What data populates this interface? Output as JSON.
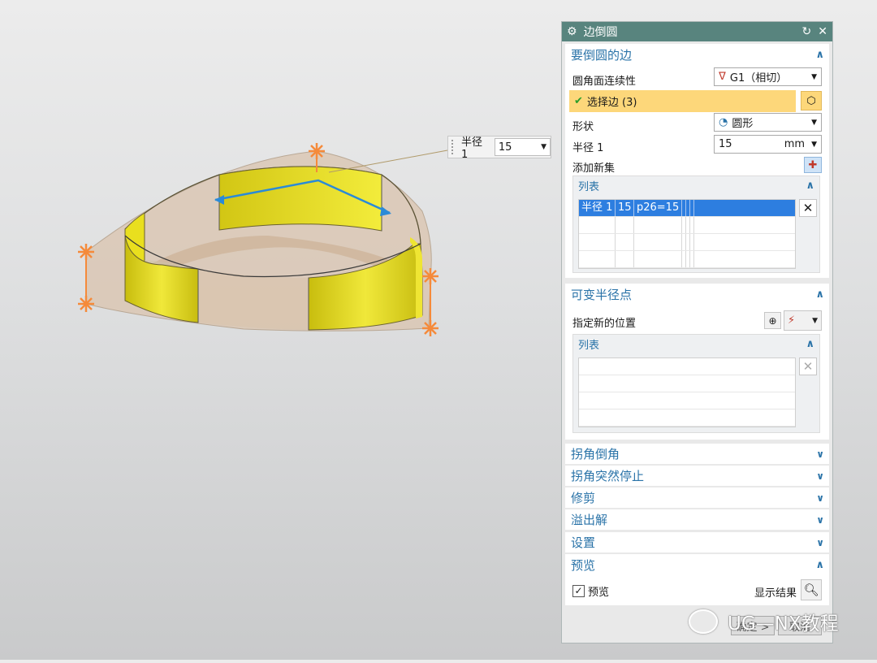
{
  "viewport": {
    "radius_tag": {
      "label": "半径 1",
      "value": "15"
    }
  },
  "dialog": {
    "title": "边倒圆",
    "section_edges": {
      "header": "要倒圆的边",
      "continuity_label": "圆角面连续性",
      "continuity_value": "G1（相切）",
      "select_edge": "选择边 (3)",
      "shape_label": "形状",
      "shape_value": "圆形",
      "radius_label": "半径 1",
      "radius_value": "15",
      "radius_unit": "mm",
      "add_new_set": "添加新集",
      "list_header": "列表",
      "list_rows": [
        {
          "name": "半径 1",
          "value": "15",
          "expr": "p26=15"
        }
      ]
    },
    "section_var_radius": {
      "header": "可变半径点",
      "specify_location": "指定新的位置",
      "list_header": "列表"
    },
    "collapsed_sections": [
      "拐角倒角",
      "拐角突然停止",
      "修剪",
      "溢出解",
      "设置"
    ],
    "section_preview": {
      "header": "预览",
      "preview_checkbox": "预览",
      "preview_checked": true,
      "show_result": "显示结果"
    },
    "footer": {
      "ok": "确定 >",
      "cancel": "取消"
    }
  },
  "watermark": "UG—NX教程",
  "colors": {
    "title_bar": "#58847e",
    "section_text": "#2a73a8",
    "selection_bar": "#fdd77a",
    "selected_row": "#2d7ee0",
    "fillet_yellow": "#e6df1a",
    "handle_orange": "#f58a3a"
  }
}
